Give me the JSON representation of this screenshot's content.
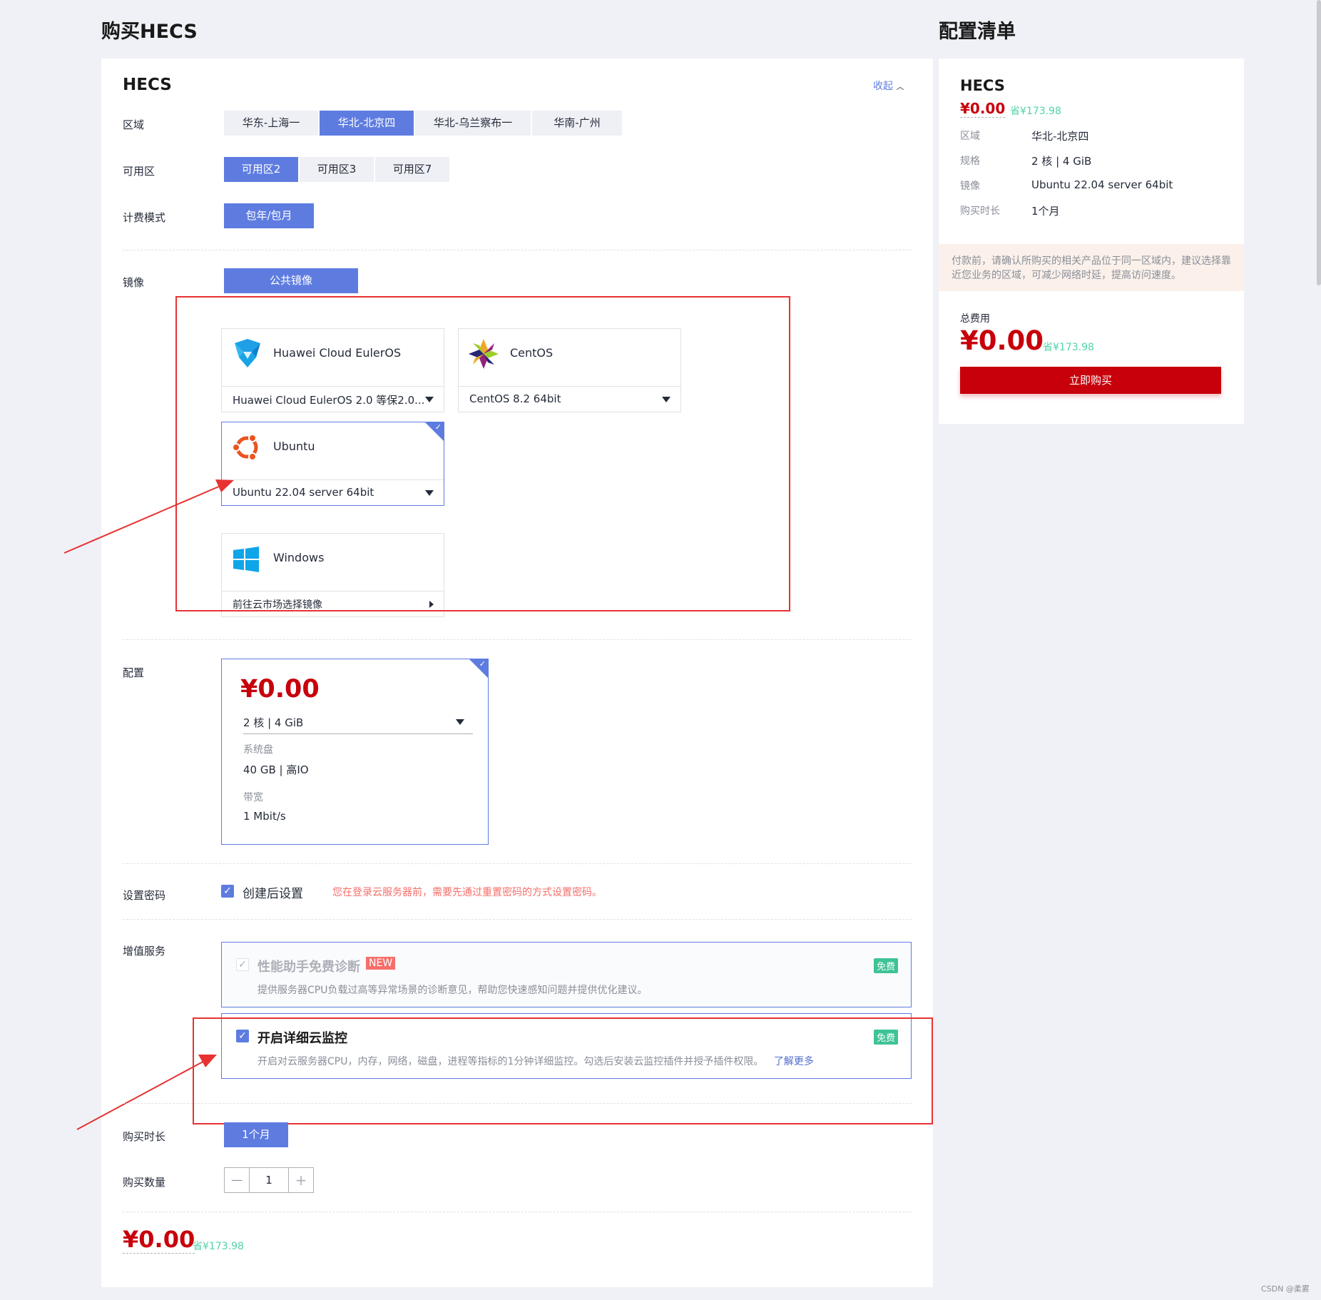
{
  "page": {
    "title": "购买HECS",
    "summary_title": "配置清单"
  },
  "product": {
    "name": "HECS",
    "collapse_label": "收起"
  },
  "region": {
    "label": "区域",
    "options": [
      "华东-上海一",
      "华北-北京四",
      "华北-乌兰察布一",
      "华南-广州"
    ],
    "selected": "华北-北京四"
  },
  "az": {
    "label": "可用区",
    "options": [
      "可用区2",
      "可用区3",
      "可用区7"
    ],
    "selected": "可用区2"
  },
  "billing": {
    "label": "计费模式",
    "options": [
      "包年/包月"
    ],
    "selected": "包年/包月"
  },
  "image": {
    "label": "镜像",
    "type_options": [
      "公共镜像"
    ],
    "selected_type": "公共镜像",
    "cards": [
      {
        "name": "Huawei Cloud EulerOS",
        "version": "Huawei Cloud EulerOS 2.0 等保2.0...",
        "icon": "euleros-icon",
        "selected": false
      },
      {
        "name": "CentOS",
        "version": "CentOS 8.2 64bit",
        "icon": "centos-icon",
        "selected": false
      },
      {
        "name": "Ubuntu",
        "version": "Ubuntu 22.04 server 64bit",
        "icon": "ubuntu-icon",
        "selected": true
      },
      {
        "name": "Windows",
        "version": "前往云市场选择镜像",
        "icon": "windows-icon",
        "selected": false
      }
    ]
  },
  "config": {
    "label": "配置",
    "price": "¥0.00",
    "spec": "2 核 | 4 GiB",
    "disk_label": "系统盘",
    "disk_value": "40 GB | 高IO",
    "bandwidth_label": "带宽",
    "bandwidth_value": "1 Mbit/s"
  },
  "password": {
    "label": "设置密码",
    "option": "创建后设置",
    "checked": true,
    "hint": "您在登录云服务器前，需要先通过重置密码的方式设置密码。"
  },
  "value_added": {
    "label": "增值服务",
    "services": [
      {
        "title": "性能助手免费诊断",
        "badge": "NEW",
        "tag": "免费",
        "desc": "提供服务器CPU负载过高等异常场景的诊断意见，帮助您快速感知问题并提供优化建议。",
        "checked": true,
        "disabled": true
      },
      {
        "title": "开启详细云监控",
        "tag": "免费",
        "desc": "开启对云服务器CPU，内存，网络，磁盘，进程等指标的1分钟详细监控。勾选后安装云监控插件并授予插件权限。",
        "link": "了解更多",
        "checked": true,
        "disabled": false
      }
    ]
  },
  "duration": {
    "label": "购买时长",
    "options": [
      "1个月"
    ],
    "selected": "1个月"
  },
  "quantity": {
    "label": "购买数量",
    "value": "1",
    "minus": "—",
    "plus": "+"
  },
  "footer": {
    "price": "¥0.00",
    "save": "省¥173.98"
  },
  "summary": {
    "product": "HECS",
    "price": "¥0.00",
    "save": "省¥173.98",
    "rows": [
      {
        "k": "区域",
        "v": "华北-北京四"
      },
      {
        "k": "规格",
        "v": "2 核 | 4 GiB"
      },
      {
        "k": "镜像",
        "v": "Ubuntu 22.04 server 64bit"
      },
      {
        "k": "购买时长",
        "v": "1个月"
      }
    ],
    "notice": "付款前，请确认所购买的相关产品位于同一区域内，建议选择靠近您业务的区域，可减少网络时延，提高访问速度。",
    "total_label": "总费用",
    "total_price": "¥0.00",
    "total_save": "省¥173.98",
    "buy_button": "立即购买"
  },
  "watermark": "CSDN @柔雾",
  "colors": {
    "accent": "#5e7ce0",
    "price_red": "#c7000b",
    "save_green": "#50d4ab",
    "annotation_red": "#e83232"
  }
}
